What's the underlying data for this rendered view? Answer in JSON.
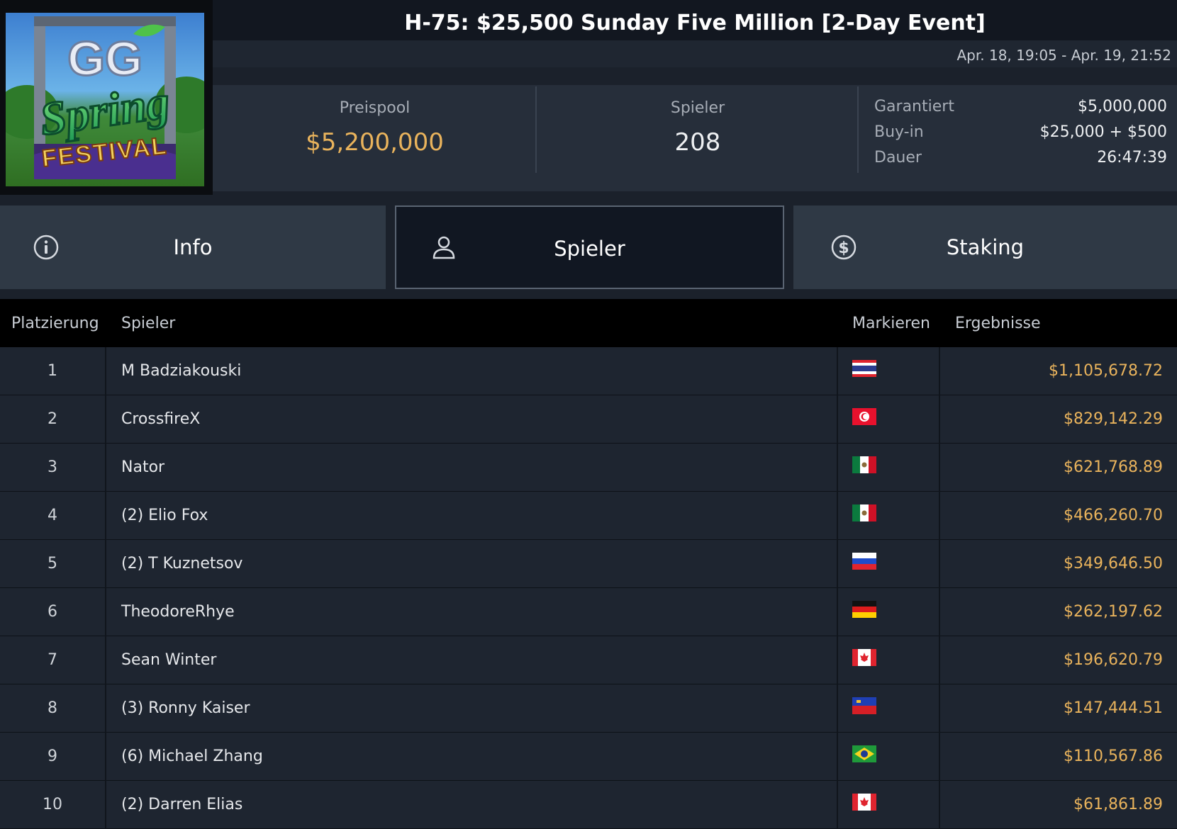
{
  "header": {
    "title": "H-75: $25,500 Sunday Five Million [2-Day Event]",
    "daterange": "Apr. 18, 19:05 - Apr. 19, 21:52"
  },
  "logo": {
    "line1": "GG",
    "line2": "Spring",
    "line3": "FESTIVAL"
  },
  "stats": {
    "prizepool_label": "Preispool",
    "prizepool_value": "$5,200,000",
    "players_label": "Spieler",
    "players_value": "208",
    "guaranteed_label": "Garantiert",
    "guaranteed_value": "$5,000,000",
    "buyin_label": "Buy-in",
    "buyin_value": "$25,000 + $500",
    "duration_label": "Dauer",
    "duration_value": "26:47:39"
  },
  "tabs": [
    {
      "label": "Info",
      "icon": "info-icon"
    },
    {
      "label": "Spieler",
      "icon": "user-icon"
    },
    {
      "label": "Staking",
      "icon": "dollar-coin-icon"
    }
  ],
  "table": {
    "columns": [
      "Platzierung",
      "Spieler",
      "Markieren",
      "Ergebnisse"
    ],
    "rows": [
      {
        "rank": "1",
        "player": "M Badziakouski",
        "flag": "thailand",
        "result": "$1,105,678.72"
      },
      {
        "rank": "2",
        "player": "CrossfireX",
        "flag": "tunisia",
        "result": "$829,142.29"
      },
      {
        "rank": "3",
        "player": "Nator",
        "flag": "mexico",
        "result": "$621,768.89"
      },
      {
        "rank": "4",
        "player": "(2) Elio Fox",
        "flag": "mexico",
        "result": "$466,260.70"
      },
      {
        "rank": "5",
        "player": "(2) T Kuznetsov",
        "flag": "russia",
        "result": "$349,646.50"
      },
      {
        "rank": "6",
        "player": "TheodoreRhye",
        "flag": "germany",
        "result": "$262,197.62"
      },
      {
        "rank": "7",
        "player": "Sean Winter",
        "flag": "canada",
        "result": "$196,620.79"
      },
      {
        "rank": "8",
        "player": "(3) Ronny Kaiser",
        "flag": "liechtenstein",
        "result": "$147,444.51"
      },
      {
        "rank": "9",
        "player": "(6) Michael Zhang",
        "flag": "brazil",
        "result": "$110,567.86"
      },
      {
        "rank": "10",
        "player": "(2) Darren Elias",
        "flag": "canada",
        "result": "$61,861.89"
      }
    ]
  },
  "colors": {
    "accent_gold": "#e9b35c",
    "background": "#1b212b",
    "row_bg": "#1e2530"
  }
}
